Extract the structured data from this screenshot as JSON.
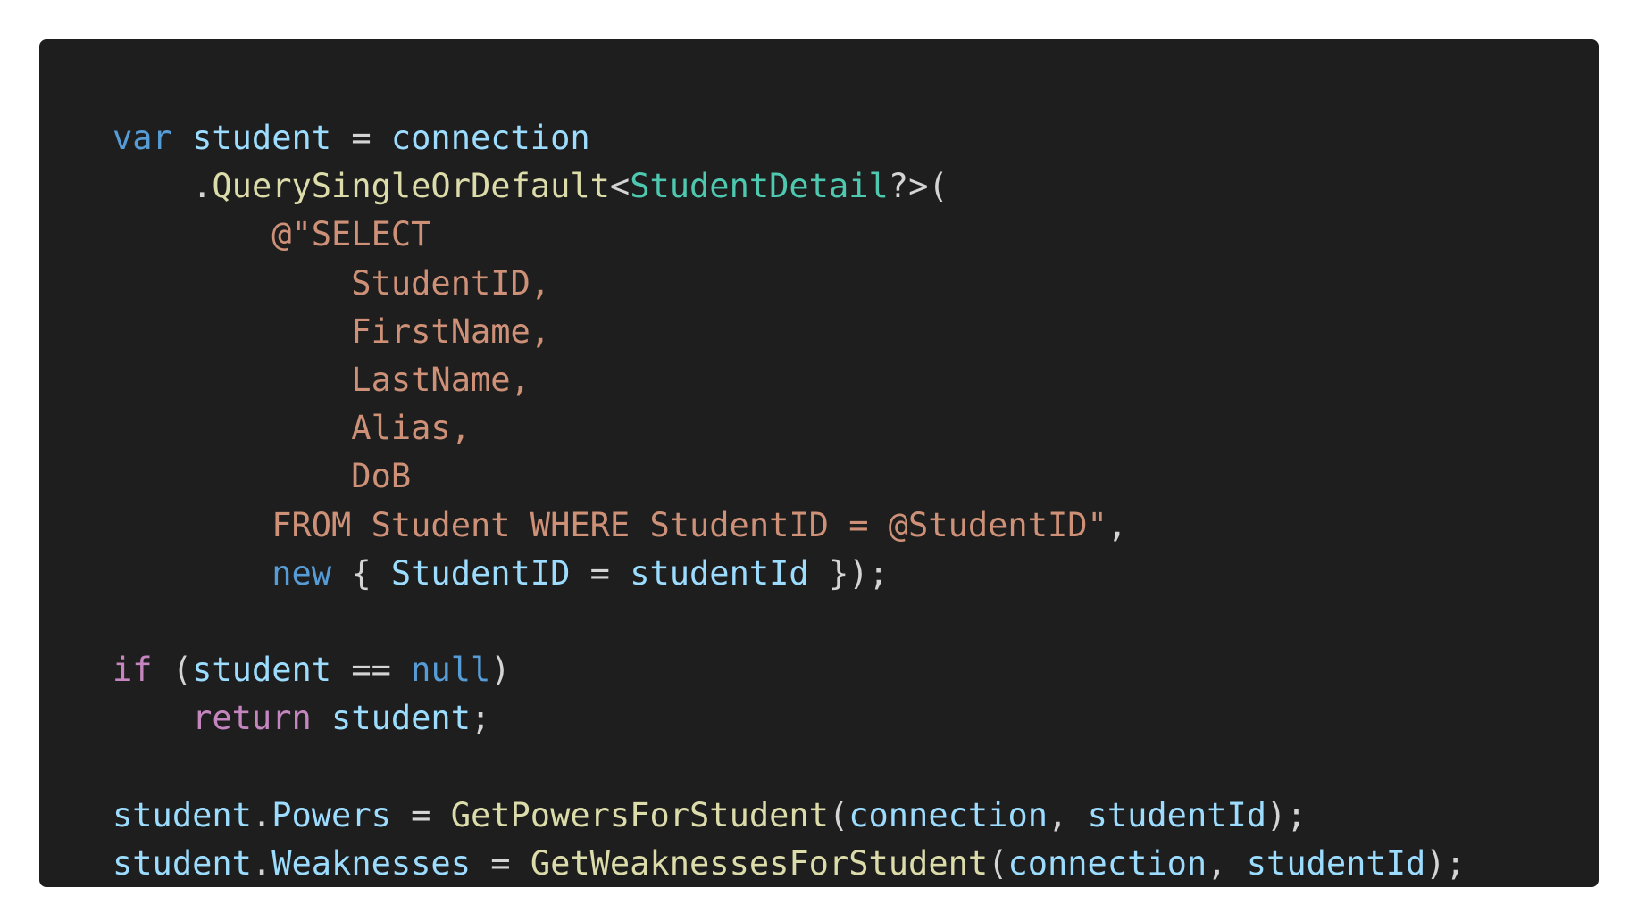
{
  "code_block": {
    "background": "#1e1e1e",
    "page_background": "#ffffff",
    "colors": {
      "keyword": "#569cd6",
      "control_keyword": "#c586c0",
      "variable": "#9cdcfe",
      "function": "#dcdcaa",
      "type": "#4ec9b0",
      "string": "#ce9178",
      "punctuation": "#d4d4d4"
    },
    "lines": [
      {
        "tokens": [
          {
            "t": "var",
            "c": "kw"
          },
          {
            "t": " ",
            "c": "op"
          },
          {
            "t": "student",
            "c": "var"
          },
          {
            "t": " = ",
            "c": "op"
          },
          {
            "t": "connection",
            "c": "var"
          }
        ]
      },
      {
        "tokens": [
          {
            "t": "    .",
            "c": "op"
          },
          {
            "t": "QuerySingleOrDefault",
            "c": "fn"
          },
          {
            "t": "<",
            "c": "op"
          },
          {
            "t": "StudentDetail",
            "c": "type"
          },
          {
            "t": "?>(",
            "c": "op"
          }
        ]
      },
      {
        "tokens": [
          {
            "t": "        @\"SELECT",
            "c": "str"
          }
        ]
      },
      {
        "tokens": [
          {
            "t": "            StudentID,",
            "c": "str"
          }
        ]
      },
      {
        "tokens": [
          {
            "t": "            FirstName,",
            "c": "str"
          }
        ]
      },
      {
        "tokens": [
          {
            "t": "            LastName,",
            "c": "str"
          }
        ]
      },
      {
        "tokens": [
          {
            "t": "            Alias,",
            "c": "str"
          }
        ]
      },
      {
        "tokens": [
          {
            "t": "            DoB",
            "c": "str"
          }
        ]
      },
      {
        "tokens": [
          {
            "t": "        FROM Student WHERE StudentID = @StudentID\"",
            "c": "str"
          },
          {
            "t": ",",
            "c": "op"
          }
        ]
      },
      {
        "tokens": [
          {
            "t": "        ",
            "c": "op"
          },
          {
            "t": "new",
            "c": "kw"
          },
          {
            "t": " { ",
            "c": "op"
          },
          {
            "t": "StudentID",
            "c": "var"
          },
          {
            "t": " = ",
            "c": "op"
          },
          {
            "t": "studentId",
            "c": "var"
          },
          {
            "t": " });",
            "c": "op"
          }
        ]
      },
      {
        "tokens": []
      },
      {
        "tokens": [
          {
            "t": "if",
            "c": "ctrl"
          },
          {
            "t": " (",
            "c": "op"
          },
          {
            "t": "student",
            "c": "var"
          },
          {
            "t": " == ",
            "c": "op"
          },
          {
            "t": "null",
            "c": "kw"
          },
          {
            "t": ")",
            "c": "op"
          }
        ]
      },
      {
        "tokens": [
          {
            "t": "    ",
            "c": "op"
          },
          {
            "t": "return",
            "c": "ctrl"
          },
          {
            "t": " ",
            "c": "op"
          },
          {
            "t": "student",
            "c": "var"
          },
          {
            "t": ";",
            "c": "op"
          }
        ]
      },
      {
        "tokens": []
      },
      {
        "tokens": [
          {
            "t": "student",
            "c": "var"
          },
          {
            "t": ".",
            "c": "op"
          },
          {
            "t": "Powers",
            "c": "var"
          },
          {
            "t": " = ",
            "c": "op"
          },
          {
            "t": "GetPowersForStudent",
            "c": "fn"
          },
          {
            "t": "(",
            "c": "op"
          },
          {
            "t": "connection",
            "c": "var"
          },
          {
            "t": ", ",
            "c": "op"
          },
          {
            "t": "studentId",
            "c": "var"
          },
          {
            "t": ");",
            "c": "op"
          }
        ]
      },
      {
        "tokens": [
          {
            "t": "student",
            "c": "var"
          },
          {
            "t": ".",
            "c": "op"
          },
          {
            "t": "Weaknesses",
            "c": "var"
          },
          {
            "t": " = ",
            "c": "op"
          },
          {
            "t": "GetWeaknessesForStudent",
            "c": "fn"
          },
          {
            "t": "(",
            "c": "op"
          },
          {
            "t": "connection",
            "c": "var"
          },
          {
            "t": ", ",
            "c": "op"
          },
          {
            "t": "studentId",
            "c": "var"
          },
          {
            "t": ");",
            "c": "op"
          }
        ]
      }
    ]
  }
}
